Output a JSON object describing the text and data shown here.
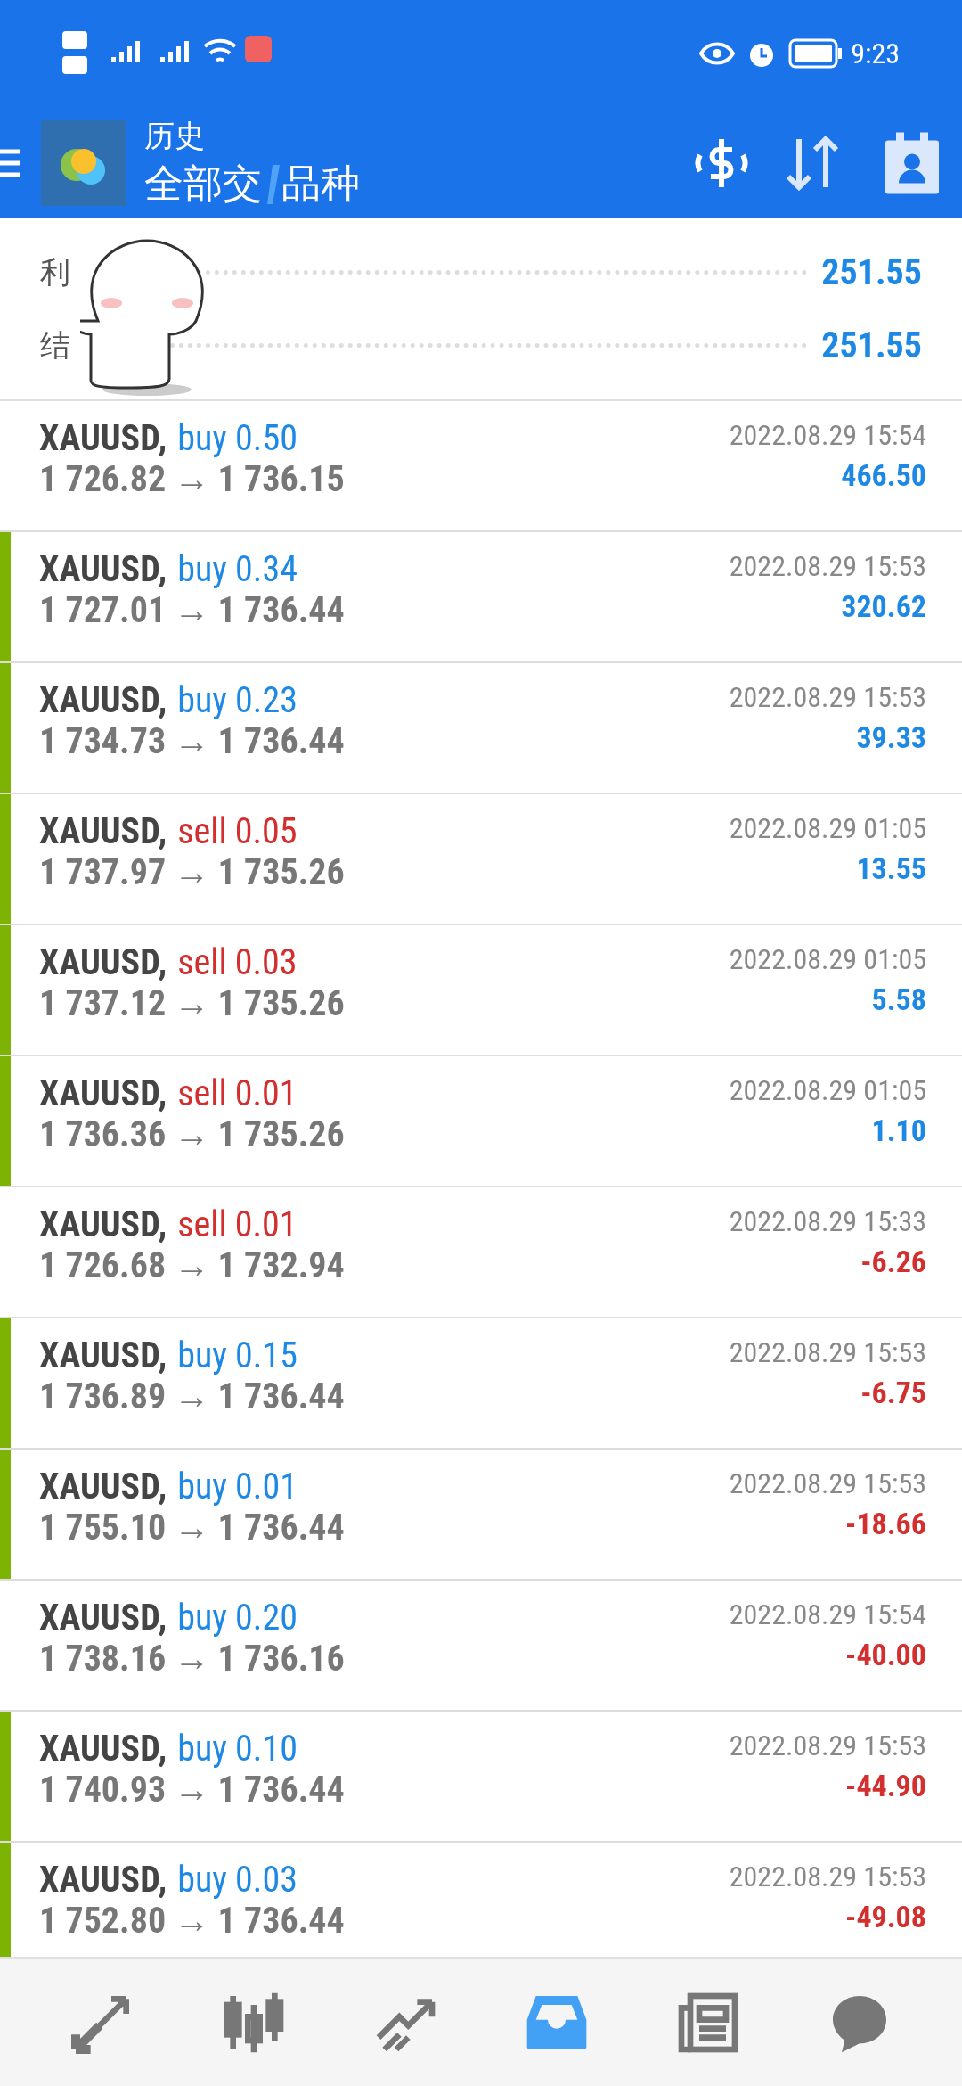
{
  "status_bar": {
    "time": "9:23"
  },
  "header": {
    "title": "历史",
    "subtitle_parts": [
      "全部交",
      "品种"
    ]
  },
  "summary": [
    {
      "label": "利",
      "value": "251.55"
    },
    {
      "label": "结",
      "value": "251.55"
    }
  ],
  "trades": [
    {
      "symbol": "XAUUSD,",
      "kind": "buy",
      "side_label": "buy 0.50",
      "prices": "1 726.82 → 1 736.15",
      "time": "2022.08.29 15:54",
      "profit": "466.50",
      "loss": false,
      "marked": false
    },
    {
      "symbol": "XAUUSD,",
      "kind": "buy",
      "side_label": "buy 0.34",
      "prices": "1 727.01 → 1 736.44",
      "time": "2022.08.29 15:53",
      "profit": "320.62",
      "loss": false,
      "marked": true
    },
    {
      "symbol": "XAUUSD,",
      "kind": "buy",
      "side_label": "buy 0.23",
      "prices": "1 734.73 → 1 736.44",
      "time": "2022.08.29 15:53",
      "profit": "39.33",
      "loss": false,
      "marked": true
    },
    {
      "symbol": "XAUUSD,",
      "kind": "sell",
      "side_label": "sell 0.05",
      "prices": "1 737.97 → 1 735.26",
      "time": "2022.08.29 01:05",
      "profit": "13.55",
      "loss": false,
      "marked": true
    },
    {
      "symbol": "XAUUSD,",
      "kind": "sell",
      "side_label": "sell 0.03",
      "prices": "1 737.12 → 1 735.26",
      "time": "2022.08.29 01:05",
      "profit": "5.58",
      "loss": false,
      "marked": true
    },
    {
      "symbol": "XAUUSD,",
      "kind": "sell",
      "side_label": "sell 0.01",
      "prices": "1 736.36 → 1 735.26",
      "time": "2022.08.29 01:05",
      "profit": "1.10",
      "loss": false,
      "marked": true
    },
    {
      "symbol": "XAUUSD,",
      "kind": "sell",
      "side_label": "sell 0.01",
      "prices": "1 726.68 → 1 732.94",
      "time": "2022.08.29 15:33",
      "profit": "-6.26",
      "loss": true,
      "marked": false
    },
    {
      "symbol": "XAUUSD,",
      "kind": "buy",
      "side_label": "buy 0.15",
      "prices": "1 736.89 → 1 736.44",
      "time": "2022.08.29 15:53",
      "profit": "-6.75",
      "loss": true,
      "marked": true
    },
    {
      "symbol": "XAUUSD,",
      "kind": "buy",
      "side_label": "buy 0.01",
      "prices": "1 755.10 → 1 736.44",
      "time": "2022.08.29 15:53",
      "profit": "-18.66",
      "loss": true,
      "marked": true
    },
    {
      "symbol": "XAUUSD,",
      "kind": "buy",
      "side_label": "buy 0.20",
      "prices": "1 738.16 → 1 736.16",
      "time": "2022.08.29 15:54",
      "profit": "-40.00",
      "loss": true,
      "marked": false
    },
    {
      "symbol": "XAUUSD,",
      "kind": "buy",
      "side_label": "buy 0.10",
      "prices": "1 740.93 → 1 736.44",
      "time": "2022.08.29 15:53",
      "profit": "-44.90",
      "loss": true,
      "marked": true
    },
    {
      "symbol": "XAUUSD,",
      "kind": "buy",
      "side_label": "buy 0.03",
      "prices": "1 752.80 → 1 736.44",
      "time": "2022.08.29 15:53",
      "profit": "-49.08",
      "loss": true,
      "marked": true
    }
  ],
  "nav": [
    {
      "kind": "quotes",
      "selected": false
    },
    {
      "kind": "chart",
      "selected": false
    },
    {
      "kind": "trade",
      "selected": false
    },
    {
      "kind": "history",
      "selected": true
    },
    {
      "kind": "news",
      "selected": false
    },
    {
      "kind": "chat",
      "selected": false
    }
  ]
}
